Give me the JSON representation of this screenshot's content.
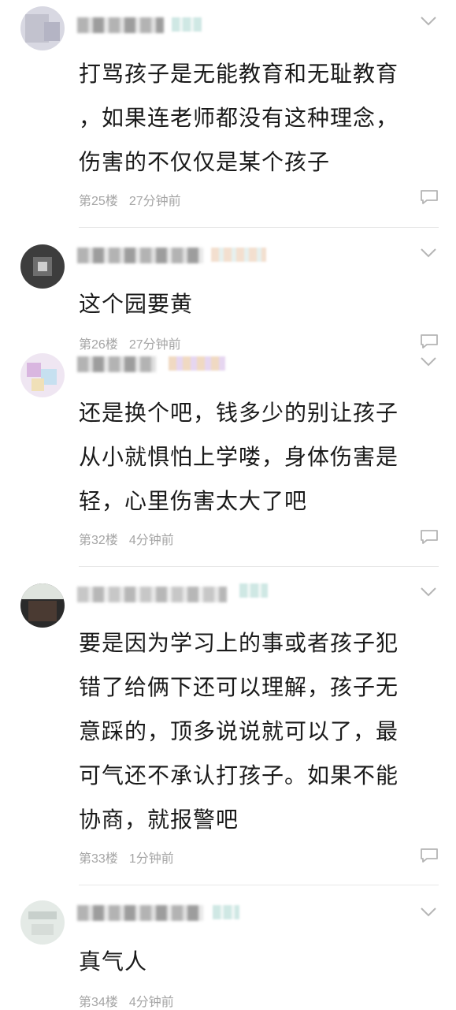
{
  "comments": [
    {
      "text": "打骂孩子是无能教育和无耻教育\n，如果连老师都没有这种理念，\n伤害的不仅仅是某个孩子",
      "floor": "第25楼",
      "time": "27分钟前"
    },
    {
      "text": "这个园要黄",
      "floor": "第26楼",
      "time": "27分钟前"
    },
    {
      "text": "还是换个吧，钱多少的别让孩子\n从小就惧怕上学喽，身体伤害是\n轻，心里伤害太大了吧",
      "floor": "第32楼",
      "time": "4分钟前"
    },
    {
      "text": "要是因为学习上的事或者孩子犯\n错了给俩下还可以理解，孩子无\n意踩的，顶多说说就可以了，最\n可气还不承认打孩子。如果不能\n协商，就报警吧",
      "floor": "第33楼",
      "time": "1分钟前"
    },
    {
      "text": "真气人",
      "floor": "第34楼",
      "time": "4分钟前"
    }
  ],
  "icons": {
    "expand": "chevron-down-icon",
    "reply": "comment-bubble-icon"
  }
}
